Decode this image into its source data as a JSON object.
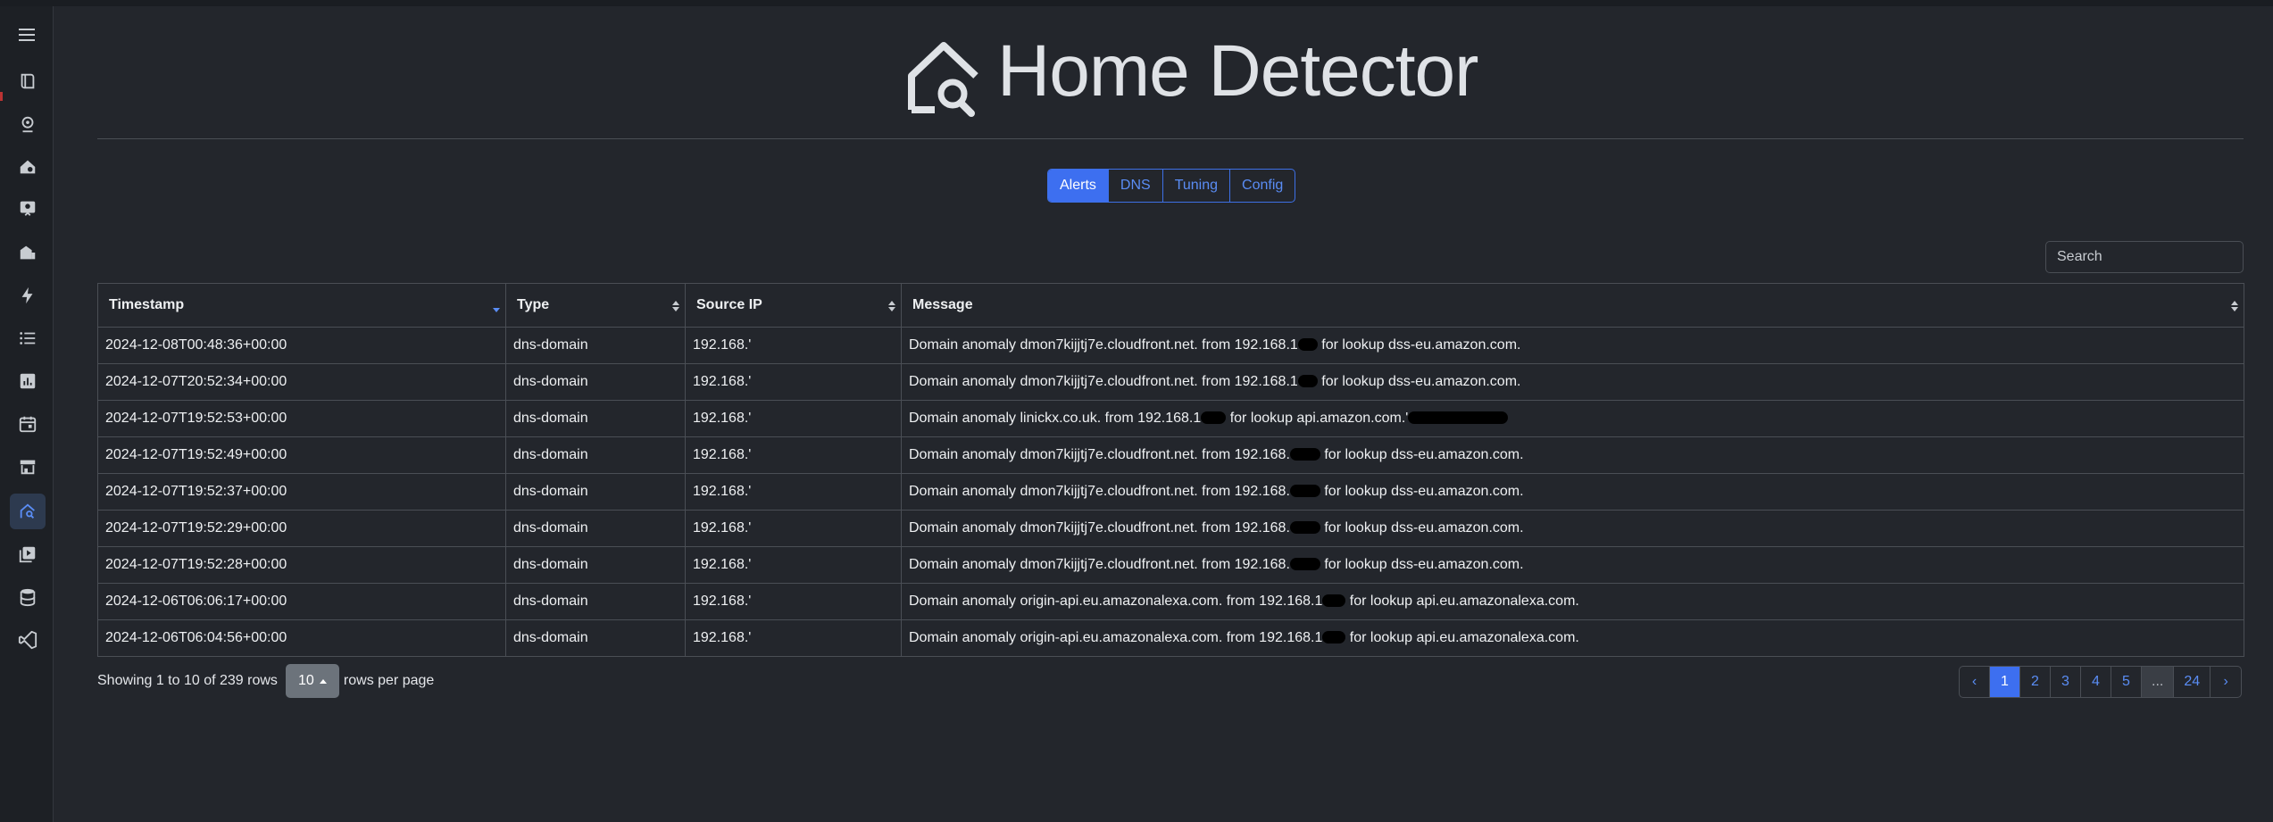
{
  "app": {
    "title": "Home Detector"
  },
  "tabs": [
    {
      "label": "Alerts",
      "active": true
    },
    {
      "label": "DNS",
      "active": false
    },
    {
      "label": "Tuning",
      "active": false
    },
    {
      "label": "Config",
      "active": false
    }
  ],
  "search": {
    "placeholder": "Search"
  },
  "table": {
    "columns": [
      "Timestamp",
      "Type",
      "Source IP",
      "Message"
    ],
    "rows": [
      {
        "timestamp": "2024-12-08T00:48:36+00:00",
        "type": "dns-domain",
        "source_ip": "192.168.'",
        "msg_pre": "Domain anomaly dmon7kijjtj7e.cloudfront.net. from 192.168.1",
        "msg_post": " for lookup dss-eu.amazon.com."
      },
      {
        "timestamp": "2024-12-07T20:52:34+00:00",
        "type": "dns-domain",
        "source_ip": "192.168.'",
        "msg_pre": "Domain anomaly dmon7kijjtj7e.cloudfront.net. from 192.168.1",
        "msg_post": " for lookup dss-eu.amazon.com."
      },
      {
        "timestamp": "2024-12-07T19:52:53+00:00",
        "type": "dns-domain",
        "source_ip": "192.168.'",
        "msg_pre": "Domain anomaly linickx.co.uk. from 192.168.1",
        "msg_post": " for lookup api.amazon.com.'"
      },
      {
        "timestamp": "2024-12-07T19:52:49+00:00",
        "type": "dns-domain",
        "source_ip": "192.168.'",
        "msg_pre": "Domain anomaly dmon7kijjtj7e.cloudfront.net. from 192.168.",
        "msg_post": " for lookup dss-eu.amazon.com."
      },
      {
        "timestamp": "2024-12-07T19:52:37+00:00",
        "type": "dns-domain",
        "source_ip": "192.168.'",
        "msg_pre": "Domain anomaly dmon7kijjtj7e.cloudfront.net. from 192.168.",
        "msg_post": " for lookup dss-eu.amazon.com."
      },
      {
        "timestamp": "2024-12-07T19:52:29+00:00",
        "type": "dns-domain",
        "source_ip": "192.168.'",
        "msg_pre": "Domain anomaly dmon7kijjtj7e.cloudfront.net. from 192.168.",
        "msg_post": " for lookup dss-eu.amazon.com."
      },
      {
        "timestamp": "2024-12-07T19:52:28+00:00",
        "type": "dns-domain",
        "source_ip": "192.168.'",
        "msg_pre": "Domain anomaly dmon7kijjtj7e.cloudfront.net. from 192.168.",
        "msg_post": " for lookup dss-eu.amazon.com."
      },
      {
        "timestamp": "2024-12-06T06:06:17+00:00",
        "type": "dns-domain",
        "source_ip": "192.168.'",
        "msg_pre": "Domain anomaly origin-api.eu.amazonalexa.com. from 192.168.1",
        "msg_post": " for lookup api.eu.amazonalexa.com."
      },
      {
        "timestamp": "2024-12-06T06:04:56+00:00",
        "type": "dns-domain",
        "source_ip": "192.168.'",
        "msg_pre": "Domain anomaly origin-api.eu.amazonalexa.com. from 192.168.1",
        "msg_post": " for lookup api.eu.amazonalexa.com."
      }
    ]
  },
  "footer": {
    "showing": "Showing 1 to 10 of 239 rows",
    "page_size": "10",
    "rows_per_page": "rows per page"
  },
  "pagination": {
    "prev": "‹",
    "pages": [
      "1",
      "2",
      "3",
      "4",
      "5",
      "...",
      "24"
    ],
    "active": "1",
    "next": "›"
  },
  "colors": {
    "accent": "#3d6ff0",
    "background": "#23262c",
    "sidebar": "#1d2025"
  },
  "sidebar": {
    "icons": [
      "menu-icon",
      "book-icon",
      "webcam-icon",
      "home-automation-icon",
      "contact-card-icon",
      "building-icon",
      "lightning-icon",
      "list-icon",
      "chart-icon",
      "calendar-icon",
      "store-icon",
      "home-search-icon",
      "media-icon",
      "database-icon",
      "vscode-icon"
    ],
    "active": "home-search-icon"
  }
}
